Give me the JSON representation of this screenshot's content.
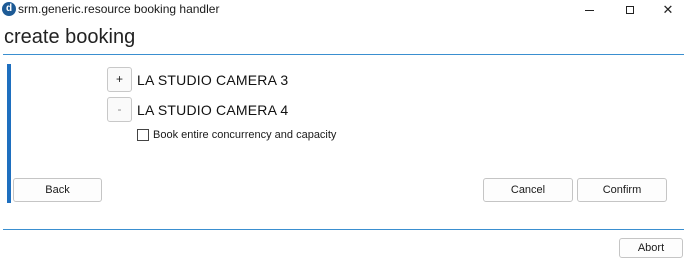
{
  "window": {
    "app_icon_letter": "d",
    "title": "srm.generic.resource booking handler",
    "minimize_icon": "minimize-icon",
    "maximize_icon": "maximize-icon",
    "close_symbol": "✕"
  },
  "page": {
    "title": "create booking"
  },
  "resources": [
    {
      "action_symbol": "+",
      "label": "LA STUDIO CAMERA 3"
    },
    {
      "action_symbol": "-",
      "label": "LA STUDIO CAMERA 4"
    }
  ],
  "options": {
    "book_entire_label": "Book entire concurrency and capacity",
    "book_entire_checked": false
  },
  "buttons": {
    "back": "Back",
    "cancel": "Cancel",
    "confirm": "Confirm",
    "abort": "Abort"
  },
  "colors": {
    "accent": "#1e6fbf",
    "rule": "#3a8fd0"
  }
}
